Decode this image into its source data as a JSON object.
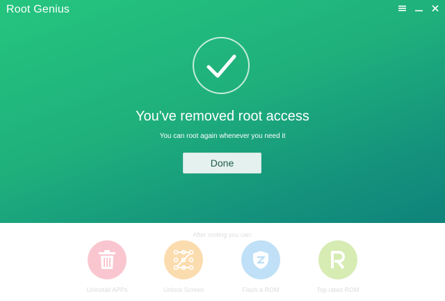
{
  "window": {
    "title": "Root Genius",
    "controls": [
      "menu-icon",
      "minimize-icon",
      "close-icon"
    ]
  },
  "result": {
    "icon": "check-circle-icon",
    "headline": "You've removed root access",
    "subline": "You can root again whenever you need it",
    "done_label": "Done"
  },
  "after": {
    "label": "After rooting you can:",
    "features": [
      {
        "label": "Uninstall APPs",
        "icon": "trash-icon",
        "color": "#f9c6cf"
      },
      {
        "label": "Unlock Screen",
        "icon": "pattern-lock-icon",
        "color": "#fbdcae"
      },
      {
        "label": "Flash a ROM",
        "icon": "shield-icon",
        "color": "#bfe0f6"
      },
      {
        "label": "Top rated ROM",
        "icon": "r-logo-icon",
        "color": "#d6ecb3"
      }
    ]
  },
  "colors": {
    "gradient_start": "#25c57e",
    "gradient_end": "#0f837b",
    "done_bg": "#e4f1ee"
  }
}
